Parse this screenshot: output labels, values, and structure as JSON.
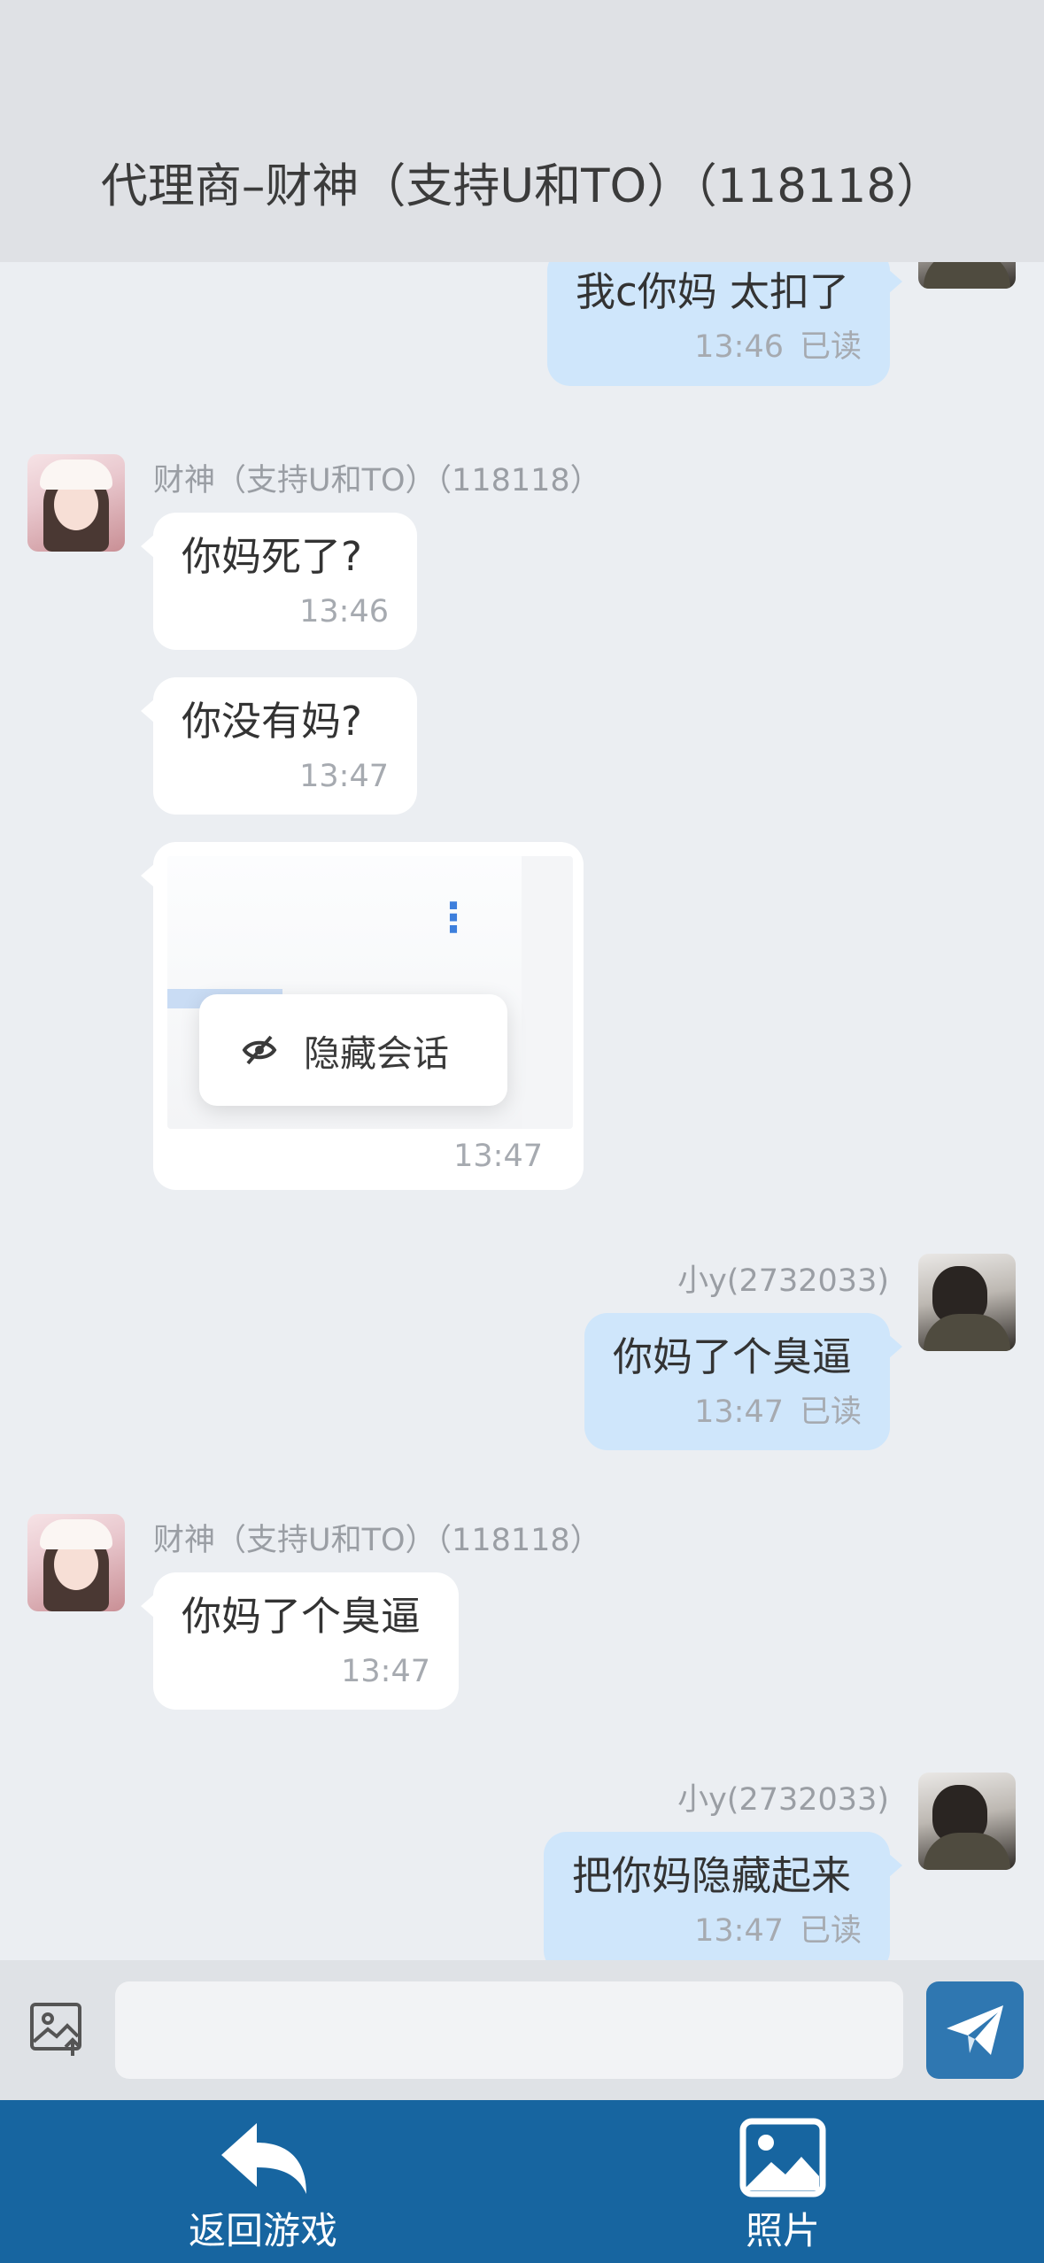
{
  "header": {
    "title": "代理商–财神（支持U和TO）（118118）"
  },
  "messages": {
    "m1": {
      "text": "我c你妈 太扣了",
      "time": "13:46",
      "status": "已读"
    },
    "m2": {
      "sender": "财神（支持U和TO）（118118）",
      "text": "你妈死了?",
      "time": "13:46"
    },
    "m3": {
      "text": "你没有妈?",
      "time": "13:47"
    },
    "m4": {
      "image_menu_label": "隐藏会话",
      "time": "13:47"
    },
    "m5": {
      "sender": "小y(2732033)",
      "text": "你妈了个臭逼",
      "time": "13:47",
      "status": "已读"
    },
    "m6": {
      "sender": "财神（支持U和TO）（118118）",
      "text": "你妈了个臭逼",
      "time": "13:47"
    },
    "m7": {
      "sender": "小y(2732033)",
      "text": "把你妈隐藏起来",
      "time": "13:47",
      "status": "已读"
    }
  },
  "composer": {
    "input_value": "",
    "placeholder": ""
  },
  "nav": {
    "back_label": "返回游戏",
    "photos_label": "照片"
  },
  "colors": {
    "header_bg": "#dfe1e5",
    "outgoing_bubble": "#cfe6fb",
    "nav_bg": "#1765a0",
    "send_button": "#2f77b1"
  },
  "icons": {
    "composer_image": "image-upload-icon",
    "send": "paper-plane-icon",
    "back": "back-arrow-icon",
    "photos": "photo-icon",
    "hide": "eye-off-icon"
  }
}
